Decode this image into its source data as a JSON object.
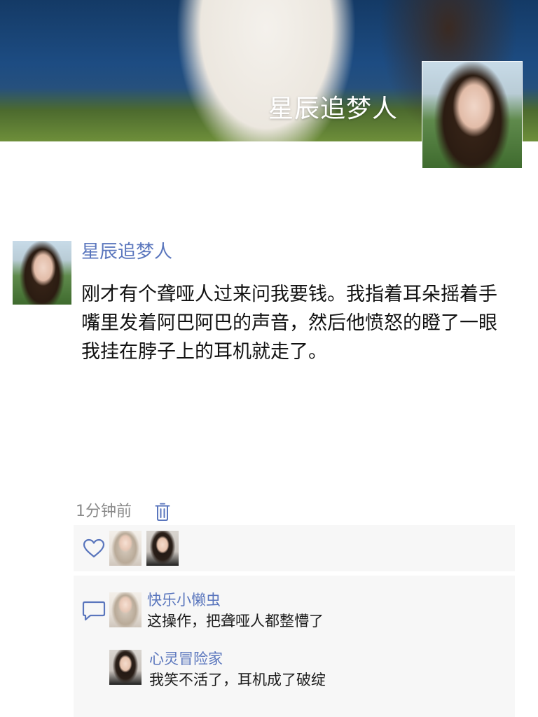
{
  "cover": {
    "user_name": "星辰追梦人"
  },
  "post": {
    "author": "星辰追梦人",
    "text": "刚才有个聋哑人过来问我要钱。我指着耳朵摇着手嘴里发着阿巴阿巴的声音，然后他愤怒的瞪了一眼我挂在脖子上的耳机就走了。",
    "time_ago": "1分钟前"
  },
  "icons": {
    "delete": "trash-icon",
    "like": "heart-icon",
    "comment": "comment-bubble-icon"
  },
  "colors": {
    "accent": "#5a76bd",
    "panel_background": "#f7f7f7",
    "secondary_text": "#8a8a8a"
  },
  "comments": [
    {
      "user": "快乐小懒虫",
      "text": "这操作，把聋哑人都整懵了"
    },
    {
      "user": "心灵冒险家",
      "text": "我笑不活了，耳机成了破绽"
    }
  ]
}
